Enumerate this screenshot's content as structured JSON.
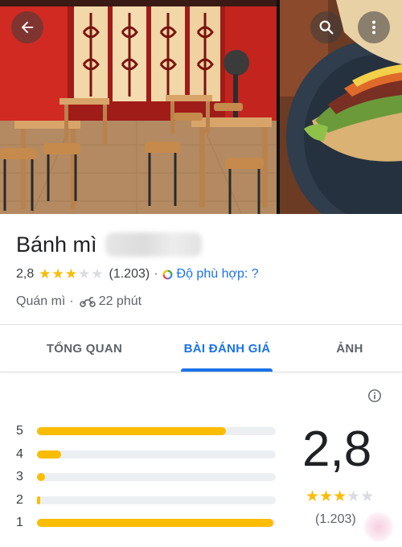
{
  "place": {
    "name": "Bánh mì",
    "rating": "2,8",
    "rating_value": 2.8,
    "review_count": "(1.203)",
    "match_label": "Độ phù hợp: ?",
    "category": "Quán mì",
    "travel_time": "22 phút"
  },
  "tabs": [
    {
      "label": "TỔNG QUAN",
      "active": false
    },
    {
      "label": "BÀI ĐÁNH GIÁ",
      "active": true
    },
    {
      "label": "ẢNH",
      "active": false
    }
  ],
  "histogram": [
    {
      "label": "5",
      "fraction": 0.79
    },
    {
      "label": "4",
      "fraction": 0.1
    },
    {
      "label": "3",
      "fraction": 0.035
    },
    {
      "label": "2",
      "fraction": 0.01
    },
    {
      "label": "1",
      "fraction": 0.99
    }
  ],
  "summary": {
    "score": "2,8",
    "stars_filled": 3,
    "stars_total": 5,
    "count": "(1.203)"
  },
  "icons": {
    "back": "arrow-left-icon",
    "search": "search-icon",
    "more": "more-vert-icon",
    "match": "google-ring-icon",
    "travel": "motorbike-icon",
    "info": "info-icon"
  },
  "colors": {
    "accent_blue": "#1a73e8",
    "star_yellow": "#fbbc04",
    "star_empty": "#dadce0",
    "bar_track": "#eceff1",
    "wall_red": "#c8261f"
  }
}
